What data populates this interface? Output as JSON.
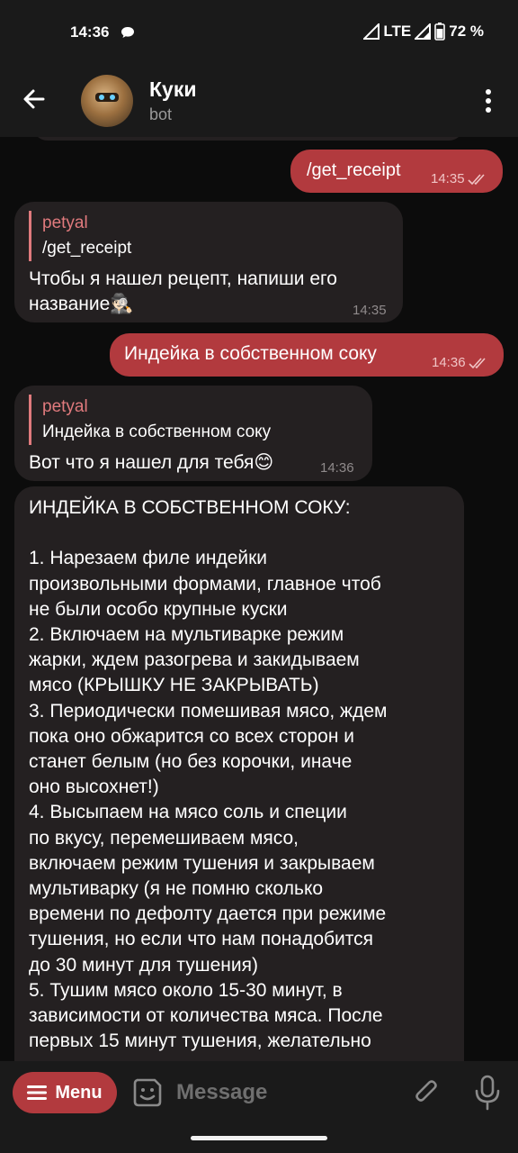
{
  "status_bar": {
    "time": "14:36",
    "network": "LTE",
    "battery": "72 %"
  },
  "header": {
    "title": "Куки",
    "subtitle": "bot"
  },
  "messages": {
    "m1": {
      "text": "/get_receipt",
      "time": "14:35"
    },
    "m2": {
      "reply_name": "petyal",
      "reply_text": "/get_receipt",
      "line1": "Чтобы я нашел рецепт, напиши его",
      "line2": "название🕵🏻",
      "time": "14:35"
    },
    "m3": {
      "text": "Индейка в собственном соку",
      "time": "14:36"
    },
    "m4": {
      "reply_name": "petyal",
      "reply_text": "Индейка в собственном соку",
      "text": "Вот что я нашел для тебя😊",
      "time": "14:36"
    },
    "m5": {
      "text": "ИНДЕЙКА В СОБСТВЕННОМ СОКУ:\n\n1. Нарезаем филе индейки\nпроизвольными формами, главное чтоб\nне были особо крупные куски\n2. Включаем на мультиварке режим\nжарки, ждем разогрева и закидываем\nмясо (КРЫШКУ НЕ ЗАКРЫВАТЬ)\n3. Периодически помешивая мясо, ждем\nпока оно обжарится со всех сторон и\nстанет белым (но без корочки, иначе\nоно высохнет!)\n4. Высыпаем на мясо соль и специи\nпо вкусу, перемешиваем мясо,\nвключаем режим тушения и закрываем\nмультиварку (я не помню сколько\nвремени по дефолту дается при режиме\nтушения, но если что нам понадобится\nдо 30 минут для тушения)\n5. Тушим мясо около 15-30 минут, в\nзависимости от количества мяса. После\nпервых 15 минут тушения, желательно"
    }
  },
  "composer": {
    "menu_label": "Menu",
    "placeholder": "Message"
  },
  "colors": {
    "accent": "#b23a3e",
    "incoming_bubble": "#242021",
    "reply_name": "#e07a7d",
    "background": "#0c0c0c"
  },
  "icons": {
    "status": [
      "message-icon",
      "lte-signal-icon",
      "signal-icon",
      "battery-icon"
    ],
    "header": [
      "back-arrow-icon",
      "more-vert-icon"
    ],
    "composer": [
      "hamburger-icon",
      "sticker-icon",
      "paperclip-icon",
      "microphone-icon"
    ]
  }
}
